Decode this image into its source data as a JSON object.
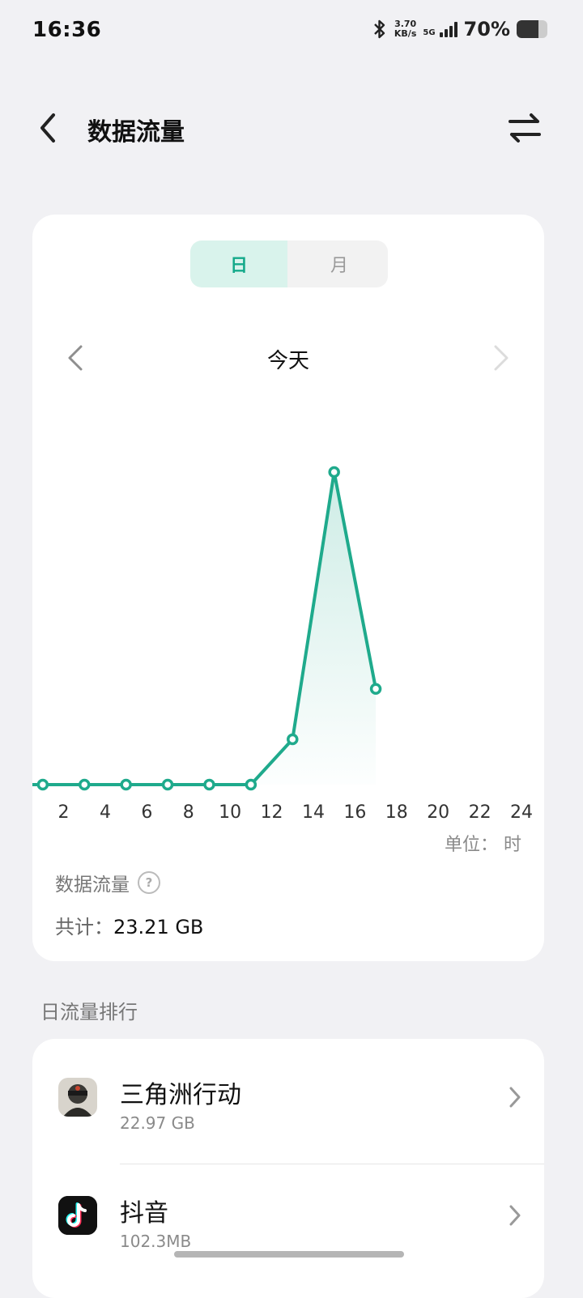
{
  "status": {
    "time": "16:36",
    "speed_value": "3.70",
    "speed_unit": "KB/s",
    "network": "5G",
    "battery": "70%",
    "battery_level": 0.7
  },
  "header": {
    "title": "数据流量"
  },
  "segment": {
    "day": "日",
    "month": "月"
  },
  "date_label": "今天",
  "chart_data": {
    "type": "line",
    "x_ticks": [
      "2",
      "4",
      "6",
      "8",
      "10",
      "12",
      "14",
      "16",
      "18",
      "20",
      "22",
      "24"
    ],
    "x": [
      1,
      3,
      5,
      7,
      9,
      11,
      13,
      15,
      17
    ],
    "values": [
      0,
      0,
      0,
      0,
      0,
      0,
      0.9,
      6.2,
      1.9
    ],
    "xlim": [
      0.5,
      24
    ],
    "ylim": [
      0,
      6.2
    ],
    "unit_label": "单位： 时",
    "accent": "#1faa8c"
  },
  "summary": {
    "title": "数据流量",
    "total_label": "共计：",
    "total_value": "23.21 GB"
  },
  "rank": {
    "title": "日流量排行",
    "items": [
      {
        "name": "三角洲行动",
        "size": "22.97 GB"
      },
      {
        "name": "抖音",
        "size": "102.3MB"
      }
    ]
  }
}
